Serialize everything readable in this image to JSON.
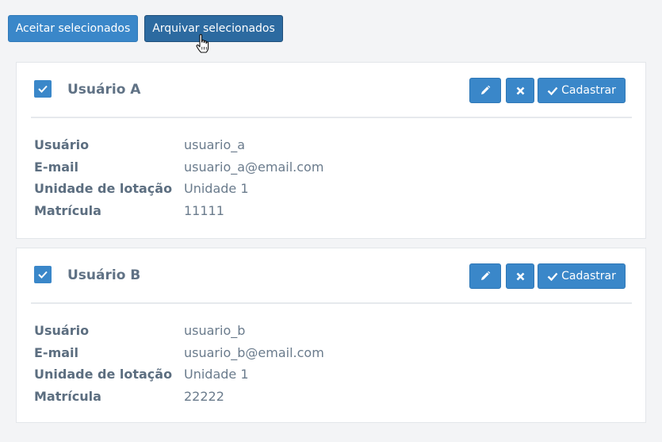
{
  "toolbar": {
    "accept_label": "Aceitar selecionados",
    "archive_label": "Arquivar selecionados"
  },
  "cards": [
    {
      "title": "Usuário A",
      "checked": true,
      "register_label": "Cadastrar",
      "fields": [
        {
          "label": "Usuário",
          "value": "usuario_a"
        },
        {
          "label": "E-mail",
          "value": "usuario_a@email.com"
        },
        {
          "label": "Unidade de lotação",
          "value": "Unidade 1"
        },
        {
          "label": "Matrícula",
          "value": "11111"
        }
      ]
    },
    {
      "title": "Usuário B",
      "checked": true,
      "register_label": "Cadastrar",
      "fields": [
        {
          "label": "Usuário",
          "value": "usuario_b"
        },
        {
          "label": "E-mail",
          "value": "usuario_b@email.com"
        },
        {
          "label": "Unidade de lotação",
          "value": "Unidade 1"
        },
        {
          "label": "Matrícula",
          "value": "22222"
        }
      ]
    }
  ],
  "icons": {
    "checkbox": "check-icon",
    "edit": "pencil-icon",
    "delete": "close-icon",
    "register": "check-icon",
    "cursor": "hand-pointer-icon"
  },
  "colors": {
    "primary": "#3a87c9",
    "primary_dark": "#2c6aa0",
    "background": "#f3f4f6"
  }
}
